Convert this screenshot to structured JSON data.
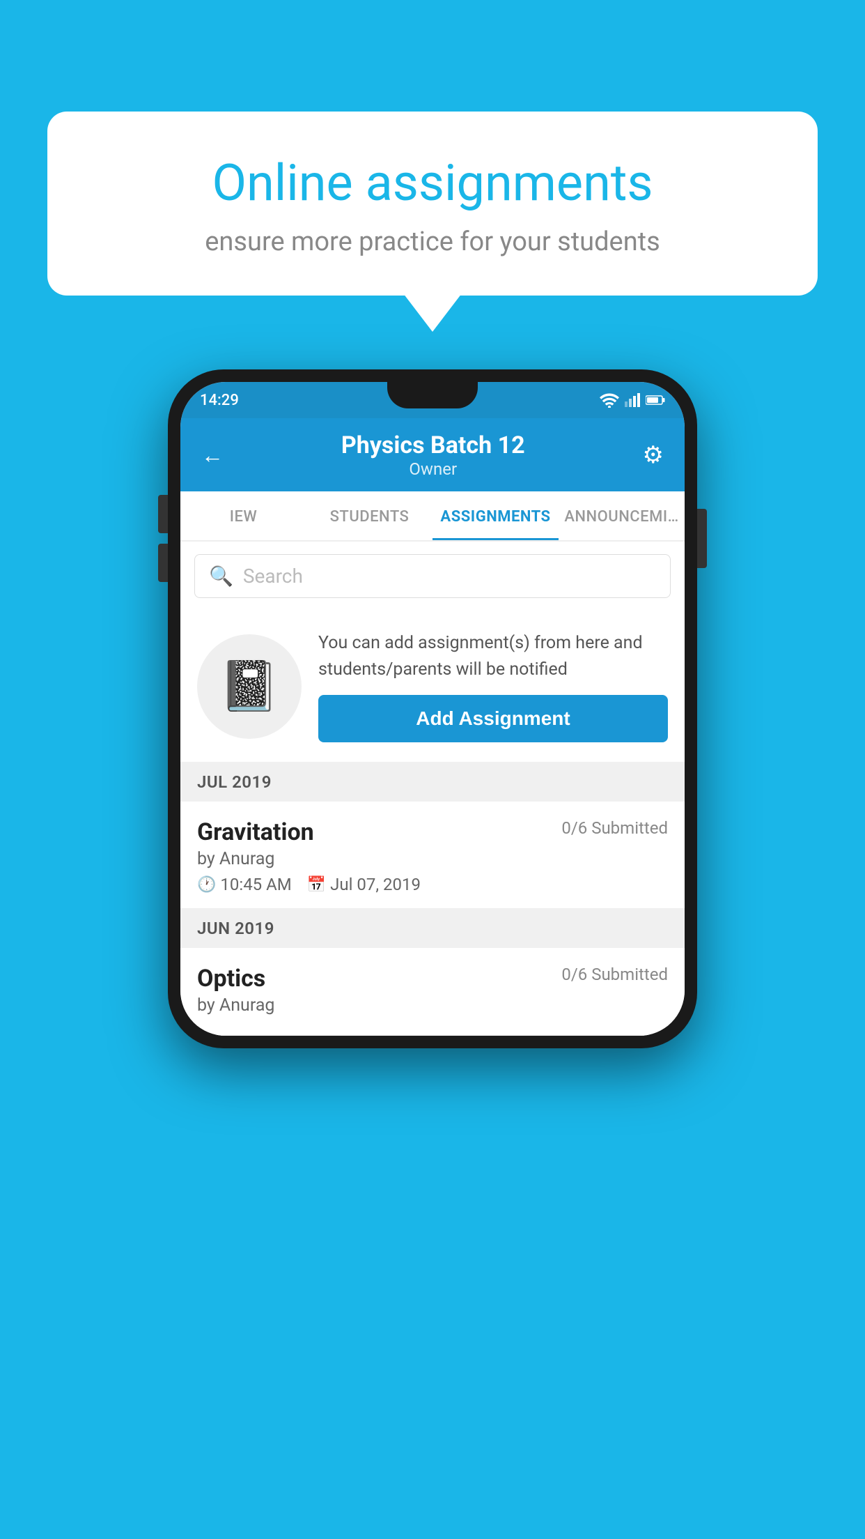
{
  "background_color": "#1ab6e8",
  "speech_bubble": {
    "title": "Online assignments",
    "subtitle": "ensure more practice for your students"
  },
  "phone": {
    "status_bar": {
      "time": "14:29"
    },
    "header": {
      "title": "Physics Batch 12",
      "subtitle": "Owner",
      "back_icon": "←",
      "settings_icon": "⚙"
    },
    "tabs": [
      {
        "label": "IEW",
        "active": false
      },
      {
        "label": "STUDENTS",
        "active": false
      },
      {
        "label": "ASSIGNMENTS",
        "active": true
      },
      {
        "label": "ANNOUNCEM…",
        "active": false
      }
    ],
    "search": {
      "placeholder": "Search"
    },
    "promo": {
      "text": "You can add assignment(s) from here and students/parents will be notified",
      "button_label": "Add Assignment"
    },
    "sections": [
      {
        "month_label": "JUL 2019",
        "assignments": [
          {
            "name": "Gravitation",
            "submitted": "0/6 Submitted",
            "by": "by Anurag",
            "time": "10:45 AM",
            "date": "Jul 07, 2019"
          }
        ]
      },
      {
        "month_label": "JUN 2019",
        "assignments": [
          {
            "name": "Optics",
            "submitted": "0/6 Submitted",
            "by": "by Anurag",
            "time": "",
            "date": ""
          }
        ]
      }
    ]
  }
}
